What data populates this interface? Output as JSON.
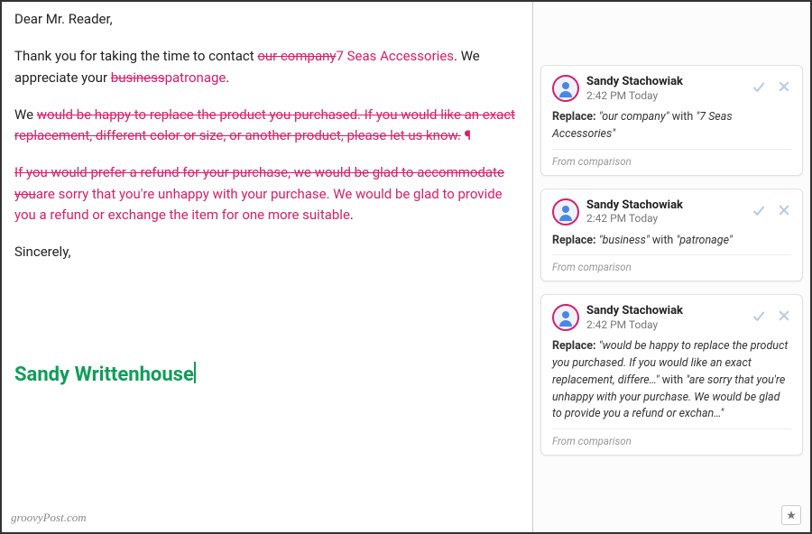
{
  "doc": {
    "greeting": "Dear Mr. Reader,",
    "p1_pre": "Thank you for taking the time to contact ",
    "p1_del1": "our company",
    "p1_ins1": "7 Seas Accessories",
    "p1_mid": ". We appreciate your ",
    "p1_del2": "business",
    "p1_ins2": "patronage",
    "p1_end": ".",
    "p2_pre": "We ",
    "p2_del": "would be happy to replace the product you purchased. If you would like an exact replacement, different color or size, or another product, please let us know.",
    "p2_pilcrow": " ¶",
    "p3_del": "If you would prefer a refund for your purchase, we would be glad to accommodate you",
    "p3_ins": "are sorry that you're unhappy with your purchase. We would be glad to provide you a refund or exchange the item for one more suitable",
    "p3_end": ".",
    "closing": "Sincerely,",
    "signature": "Sandy Writtenhouse",
    "watermark": "groovyPost.com"
  },
  "cards": {
    "c1": {
      "user": "Sandy Stachowiak",
      "time": "2:42 PM Today",
      "label": "Replace:",
      "old": "\"our company\"",
      "with": "with",
      "new": "\"7 Seas Accessories\"",
      "source": "From comparison"
    },
    "c2": {
      "user": "Sandy Stachowiak",
      "time": "2:42 PM Today",
      "label": "Replace:",
      "old": "\"business\"",
      "with": "with",
      "new": "\"patronage\"",
      "source": "From comparison"
    },
    "c3": {
      "user": "Sandy Stachowiak",
      "time": "2:42 PM Today",
      "label": "Replace:",
      "old": "\"would be happy to replace the product you purchased. If you would like an exact replacement, differe…\"",
      "with": "with",
      "new": "\"are sorry that you're unhappy with your purchase. We would be glad to provide you a refund or exchan…\"",
      "source": "From comparison"
    }
  }
}
